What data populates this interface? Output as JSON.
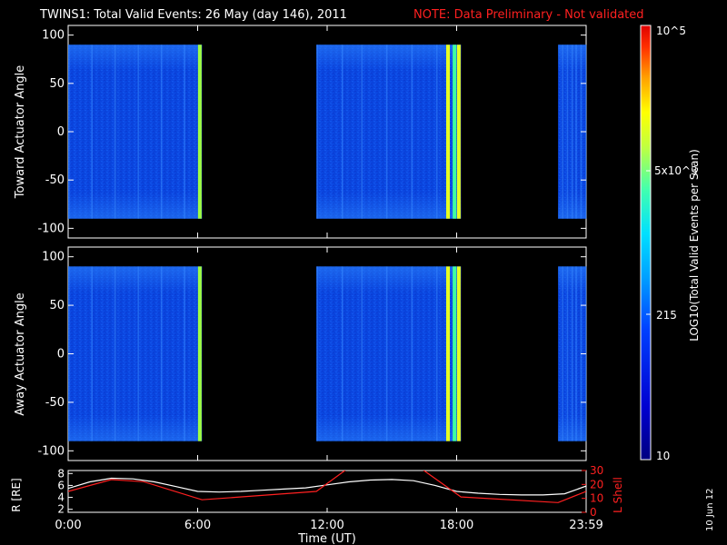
{
  "title": {
    "main": "TWINS1: Total Valid Events: 26 May (day 146), 2011",
    "note": "NOTE: Data Preliminary - Not validated"
  },
  "footer": {
    "date_stamp": "10 Jun 12",
    "xlabel": "Time (UT)"
  },
  "colors": {
    "background": "#000000",
    "axis": "#ffffff",
    "note": "#ff2020",
    "lshell_line": "#ff2020",
    "r_line": "#ffffff"
  },
  "chart_data": [
    {
      "type": "heatmap",
      "panel": "top",
      "ylabel": "Toward Actuator Angle",
      "ylim": [
        -110,
        110
      ],
      "yticks": [
        100,
        50,
        0,
        -50,
        -100
      ],
      "xlim": [
        0,
        24
      ],
      "data_intervals_hours": [
        [
          0,
          6.2
        ],
        [
          11.5,
          18.2
        ],
        [
          22.7,
          24
        ]
      ],
      "data_angle_range": [
        -90,
        90
      ],
      "background_level": "blue (~100-200 events)",
      "enhanced_stripes_hours": [
        6.1,
        17.6,
        17.9,
        18.1
      ]
    },
    {
      "type": "heatmap",
      "panel": "middle",
      "ylabel": "Away Actuator Angle",
      "ylim": [
        -110,
        110
      ],
      "yticks": [
        100,
        50,
        0,
        -50,
        -100
      ],
      "xlim": [
        0,
        24
      ],
      "data_intervals_hours": [
        [
          0,
          6.2
        ],
        [
          11.5,
          18.2
        ],
        [
          22.7,
          24
        ]
      ],
      "data_angle_range": [
        -90,
        90
      ],
      "background_level": "blue (~100-200 events)",
      "enhanced_stripes_hours": [
        6.1,
        17.6,
        17.9,
        18.1
      ]
    },
    {
      "type": "line",
      "panel": "bottom",
      "ylabel_left": "R [RE]",
      "ylabel_right": "L Shell",
      "y_left_ticks": [
        8,
        6,
        4,
        2
      ],
      "y_left_lim": [
        1.5,
        8.5
      ],
      "y_right_ticks": [
        30,
        20,
        10,
        0
      ],
      "y_right_lim": [
        0,
        30
      ],
      "x_tick_labels": [
        "0:00",
        "6:00",
        "12:00",
        "18:00",
        "23:59"
      ],
      "x_tick_hours": [
        0,
        6,
        12,
        18,
        24
      ],
      "xlim": [
        0,
        24
      ],
      "series": [
        {
          "name": "R [RE]",
          "axis": "left",
          "color": "#ffffff",
          "x": [
            0,
            1,
            2,
            3,
            4,
            5,
            6,
            7,
            8,
            9,
            10,
            11,
            12,
            13,
            14,
            15,
            16,
            17,
            18,
            19,
            20,
            21,
            22,
            23,
            24
          ],
          "y": [
            5.5,
            6.6,
            7.2,
            7.1,
            6.6,
            5.8,
            5.0,
            4.9,
            5.0,
            5.2,
            5.4,
            5.6,
            6.1,
            6.6,
            6.9,
            7.0,
            6.8,
            6.0,
            5.0,
            4.7,
            4.5,
            4.4,
            4.4,
            4.6,
            5.9
          ]
        },
        {
          "name": "L Shell",
          "axis": "right",
          "color": "#ff2020",
          "x": [
            0,
            2,
            3.5,
            6.2,
            11.5,
            13,
            16.3,
            18.2,
            22.7,
            24
          ],
          "y": [
            15,
            23.5,
            22,
            9,
            15,
            32,
            32,
            11,
            7,
            15
          ]
        }
      ]
    },
    {
      "type": "heatmap",
      "panel": "colorbar",
      "label": "LOG10(Total Valid Events per Scan)",
      "tick_labels": [
        "10^5",
        "5x10^3",
        "215",
        "10"
      ],
      "tick_values": [
        100000,
        5000,
        215,
        10
      ],
      "scale": "log",
      "range": [
        10,
        100000
      ]
    }
  ]
}
